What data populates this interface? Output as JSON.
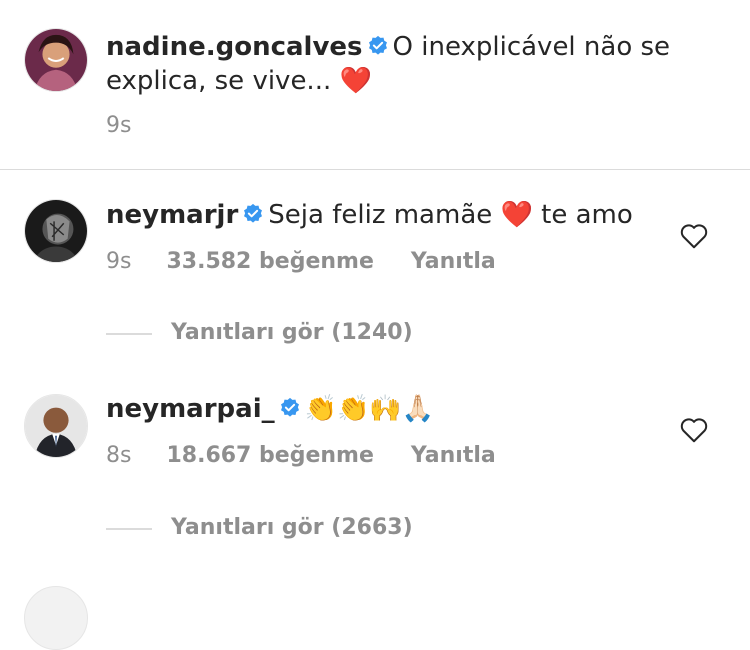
{
  "caption": {
    "username": "nadine.goncalves",
    "text_line1": "O inexplicável não se",
    "text_line2": "explica, se vive... ❤️",
    "time": "9s"
  },
  "comments": [
    {
      "username": "neymarjr",
      "text": "Seja feliz mamãe ❤️  te amo",
      "time": "9s",
      "likes": "33.582 beğenme",
      "reply_label": "Yanıtla",
      "view_replies": "Yanıtları gör (1240)"
    },
    {
      "username": "neymarpai_",
      "text": "👏👏🙌🙏🏻",
      "time": "8s",
      "likes": "18.667 beğenme",
      "reply_label": "Yanıtla",
      "view_replies": "Yanıtları gör (2663)"
    }
  ],
  "colors": {
    "verified": "#3897f0",
    "muted": "#8e8e8e",
    "divider": "#dbdbdb",
    "heart": "#e0245e"
  },
  "icons": [
    "verified-badge-icon",
    "heart-outline-icon"
  ]
}
